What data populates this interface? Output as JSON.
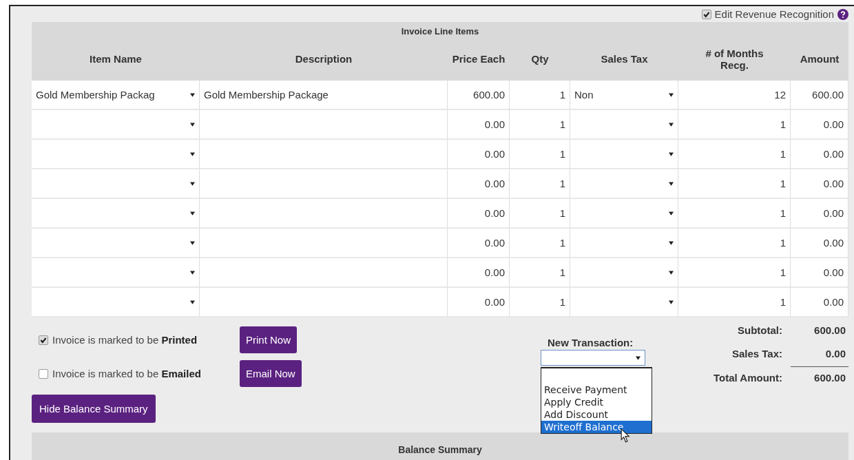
{
  "revenue_recognition": {
    "label": "Edit Revenue Recognition",
    "checked": true
  },
  "line_items": {
    "title": "Invoice Line Items",
    "columns": [
      "Item Name",
      "Description",
      "Price Each",
      "Qty",
      "Sales Tax",
      "# of Months Recg.",
      "Amount"
    ],
    "rows": [
      {
        "item": "Gold Membership Packag",
        "description": "Gold Membership Package",
        "price": "600.00",
        "qty": "1",
        "sales_tax": "Non",
        "months": "12",
        "amount": "600.00"
      },
      {
        "price": "0.00",
        "qty": "1",
        "months": "1",
        "amount": "0.00"
      },
      {
        "price": "0.00",
        "qty": "1",
        "months": "1",
        "amount": "0.00"
      },
      {
        "price": "0.00",
        "qty": "1",
        "months": "1",
        "amount": "0.00"
      },
      {
        "price": "0.00",
        "qty": "1",
        "months": "1",
        "amount": "0.00"
      },
      {
        "price": "0.00",
        "qty": "1",
        "months": "1",
        "amount": "0.00"
      },
      {
        "price": "0.00",
        "qty": "1",
        "months": "1",
        "amount": "0.00"
      },
      {
        "price": "0.00",
        "qty": "1",
        "months": "1",
        "amount": "0.00"
      }
    ]
  },
  "delivery": [
    {
      "label": "Invoice is marked to be **Printed**",
      "checked": true,
      "button": "Print Now"
    },
    {
      "label": "Invoice is marked to be **Emailed**",
      "checked": false,
      "button": "Email Now"
    }
  ],
  "balance_button": "Hide Balance Summary",
  "new_transaction": {
    "label": "New Transaction:",
    "options": [
      {
        "label": "Receive Payment",
        "selected": false
      },
      {
        "label": "Apply Credit",
        "selected": false
      },
      {
        "label": "Add Discount",
        "selected": false
      },
      {
        "label": "Writeoff Balance",
        "selected": true
      }
    ]
  },
  "totals": [
    {
      "label": "Subtotal:",
      "value": "600.00"
    },
    {
      "label": "Sales Tax:",
      "value": "0.00"
    },
    {
      "label": "Total Amount:",
      "value": "600.00"
    }
  ],
  "balance_summary": {
    "title": "Balance Summary"
  }
}
